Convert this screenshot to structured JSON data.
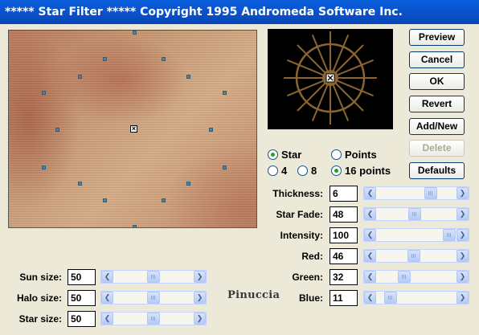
{
  "window": {
    "title": "***** Star Filter *****  Copyright 1995 Andromeda Software Inc."
  },
  "buttons": [
    {
      "label": "Preview",
      "enabled": true
    },
    {
      "label": "Cancel",
      "enabled": true
    },
    {
      "label": "OK",
      "enabled": true
    },
    {
      "label": "Revert",
      "enabled": true
    },
    {
      "label": "Add/New",
      "enabled": true
    },
    {
      "label": "Delete",
      "enabled": false
    },
    {
      "label": "Defaults",
      "enabled": true
    }
  ],
  "options": {
    "star": "Star",
    "points": "Points",
    "four": "4",
    "eight": "8",
    "sixteen": "16 points",
    "selected_shape": "Star",
    "selected_count": "16 points"
  },
  "right_params": [
    {
      "label": "Thickness:",
      "value": "6",
      "level": 0.72
    },
    {
      "label": "Star Fade:",
      "value": "48",
      "level": 0.48
    },
    {
      "label": "Intensity:",
      "value": "100",
      "level": 1.0
    },
    {
      "label": "Red:",
      "value": "46",
      "level": 0.46
    },
    {
      "label": "Green:",
      "value": "32",
      "level": 0.32
    },
    {
      "label": "Blue:",
      "value": "11",
      "level": 0.11
    }
  ],
  "left_params": [
    {
      "label": "Sun size:",
      "value": "50",
      "level": 0.5
    },
    {
      "label": "Halo size:",
      "value": "50",
      "level": 0.5
    },
    {
      "label": "Star size:",
      "value": "50",
      "level": 0.5
    }
  ],
  "watermark": "Pinuccia",
  "colors": {
    "titlebar": "#0a5fdc",
    "star_color": "#8b6530",
    "radio_dot": "#21a121"
  }
}
